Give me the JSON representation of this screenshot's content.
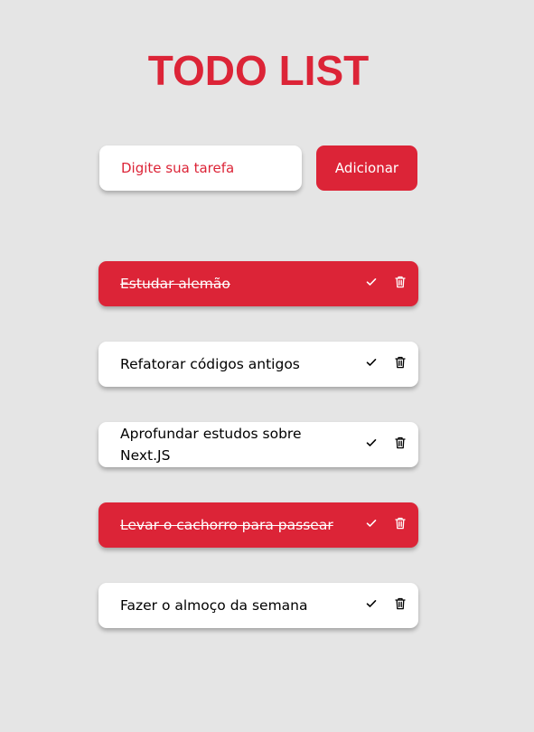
{
  "header": {
    "title": "TODO LIST"
  },
  "form": {
    "placeholder": "Digite sua tarefa",
    "value": "",
    "add_label": "Adicionar"
  },
  "tasks": [
    {
      "text": "Estudar alemão",
      "completed": true
    },
    {
      "text": "Refatorar códigos antigos",
      "completed": false
    },
    {
      "text": "Aprofundar estudos sobre Next.JS",
      "completed": false
    },
    {
      "text": "Levar o cachorro para passear",
      "completed": true
    },
    {
      "text": "Fazer o almoço da semana",
      "completed": false
    }
  ],
  "icons": {
    "complete": "check-icon",
    "delete": "trash-icon"
  },
  "colors": {
    "accent": "#dc2437",
    "background": "#e5e5e5",
    "card": "#ffffff"
  }
}
